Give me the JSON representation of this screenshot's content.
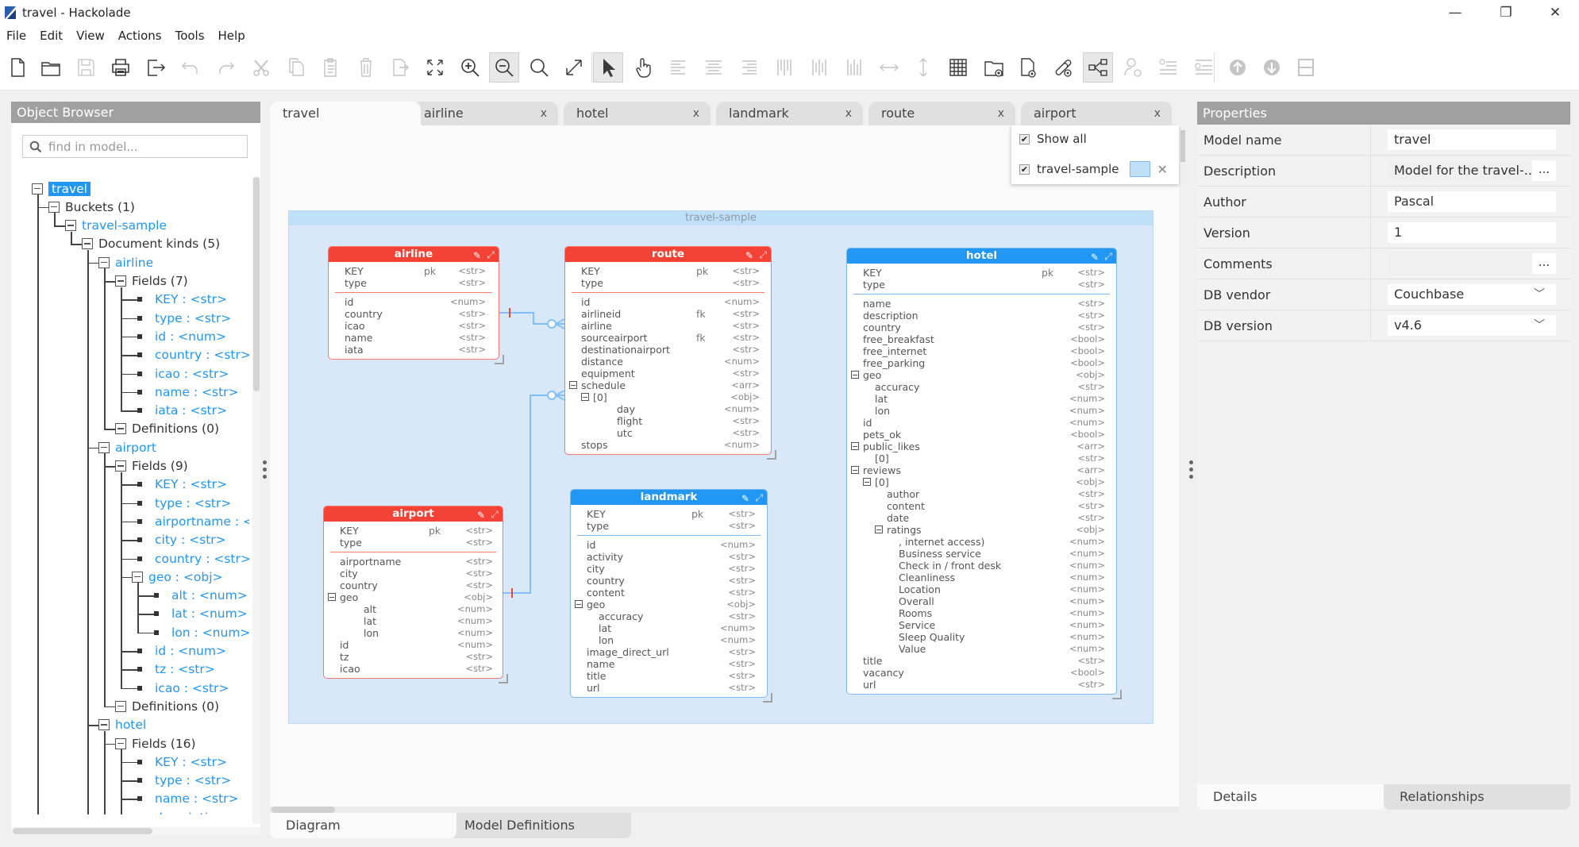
{
  "window": {
    "title": "travel - Hackolade",
    "controls": {
      "minimize": "—",
      "restore": "❐",
      "close": "✕"
    }
  },
  "menu": [
    "File",
    "Edit",
    "View",
    "Actions",
    "Tools",
    "Help"
  ],
  "toolbar": [
    {
      "name": "new-file-icon",
      "enabled": true
    },
    {
      "name": "open-folder-icon",
      "enabled": true
    },
    {
      "name": "save-icon",
      "enabled": false
    },
    {
      "name": "print-icon",
      "enabled": true
    },
    {
      "name": "export-icon",
      "enabled": true
    },
    {
      "name": "undo-icon",
      "enabled": false
    },
    {
      "name": "redo-icon",
      "enabled": false
    },
    {
      "name": "cut-icon",
      "enabled": false
    },
    {
      "name": "copy-icon",
      "enabled": false
    },
    {
      "name": "paste-icon",
      "enabled": false
    },
    {
      "name": "delete-icon",
      "enabled": false
    },
    {
      "name": "duplicate-icon",
      "enabled": false
    },
    {
      "name": "fit-to-screen-icon",
      "enabled": true
    },
    {
      "name": "zoom-in-icon",
      "enabled": true
    },
    {
      "name": "zoom-out-icon",
      "enabled": true,
      "active": true
    },
    {
      "name": "zoom-actual-icon",
      "enabled": true
    },
    {
      "name": "expand-icon",
      "enabled": true
    },
    {
      "name": "pointer-icon",
      "enabled": true,
      "active": true
    },
    {
      "name": "pan-hand-icon",
      "enabled": true
    },
    {
      "name": "align-left-icon",
      "enabled": false
    },
    {
      "name": "align-center-icon",
      "enabled": false
    },
    {
      "name": "align-right-icon",
      "enabled": false
    },
    {
      "name": "align-top-icon",
      "enabled": false
    },
    {
      "name": "align-middle-icon",
      "enabled": false
    },
    {
      "name": "align-bottom-icon",
      "enabled": false
    },
    {
      "name": "distribute-horizontal-icon",
      "enabled": false
    },
    {
      "name": "distribute-vertical-icon",
      "enabled": false
    },
    {
      "name": "grid-icon",
      "enabled": true
    },
    {
      "name": "add-container-icon",
      "enabled": true
    },
    {
      "name": "add-entity-icon",
      "enabled": true
    },
    {
      "name": "add-relationship-icon",
      "enabled": true
    },
    {
      "name": "show-relationships-icon",
      "enabled": true,
      "active": true
    },
    {
      "name": "add-attribute-icon",
      "enabled": false
    },
    {
      "name": "insert-field-icon",
      "enabled": false
    },
    {
      "name": "append-field-icon",
      "enabled": false
    },
    {
      "name": "move-up-icon",
      "enabled": false
    },
    {
      "name": "move-down-icon",
      "enabled": false
    },
    {
      "name": "split-view-icon",
      "enabled": false
    }
  ],
  "object_browser": {
    "title": "Object Browser",
    "search_placeholder": "find in model...",
    "tree": [
      {
        "label": "travel",
        "level": 0,
        "kind": "box",
        "selected": true
      },
      {
        "label": "Buckets (1)",
        "level": 1,
        "kind": "box"
      },
      {
        "label": "travel-sample",
        "level": 2,
        "kind": "box",
        "blue": true
      },
      {
        "label": "Document kinds (5)",
        "level": 3,
        "kind": "box"
      },
      {
        "label": "airline",
        "level": 4,
        "kind": "box",
        "blue": true
      },
      {
        "label": "Fields (7)",
        "level": 5,
        "kind": "box"
      },
      {
        "label": "KEY : <str>",
        "level": 6,
        "kind": "leaf",
        "blue": true
      },
      {
        "label": "type : <str>",
        "level": 6,
        "kind": "leaf",
        "blue": true
      },
      {
        "label": "id : <num>",
        "level": 6,
        "kind": "leaf",
        "blue": true
      },
      {
        "label": "country : <str>",
        "level": 6,
        "kind": "leaf",
        "blue": true
      },
      {
        "label": "icao : <str>",
        "level": 6,
        "kind": "leaf",
        "blue": true
      },
      {
        "label": "name : <str>",
        "level": 6,
        "kind": "leaf",
        "blue": true
      },
      {
        "label": "iata : <str>",
        "level": 6,
        "kind": "leaf",
        "blue": true
      },
      {
        "label": "Definitions (0)",
        "level": 5,
        "kind": "box"
      },
      {
        "label": "airport",
        "level": 4,
        "kind": "box",
        "blue": true
      },
      {
        "label": "Fields (9)",
        "level": 5,
        "kind": "box"
      },
      {
        "label": "KEY : <str>",
        "level": 6,
        "kind": "leaf",
        "blue": true
      },
      {
        "label": "type : <str>",
        "level": 6,
        "kind": "leaf",
        "blue": true
      },
      {
        "label": "airportname : <str>",
        "level": 6,
        "kind": "leaf",
        "blue": true
      },
      {
        "label": "city : <str>",
        "level": 6,
        "kind": "leaf",
        "blue": true
      },
      {
        "label": "country : <str>",
        "level": 6,
        "kind": "leaf",
        "blue": true
      },
      {
        "label": "geo : <obj>",
        "level": 6,
        "kind": "box",
        "blue": true
      },
      {
        "label": "alt : <num>",
        "level": 7,
        "kind": "leaf",
        "blue": true
      },
      {
        "label": "lat : <num>",
        "level": 7,
        "kind": "leaf",
        "blue": true
      },
      {
        "label": "lon : <num>",
        "level": 7,
        "kind": "leaf",
        "blue": true
      },
      {
        "label": "id : <num>",
        "level": 6,
        "kind": "leaf",
        "blue": true
      },
      {
        "label": "tz : <str>",
        "level": 6,
        "kind": "leaf",
        "blue": true
      },
      {
        "label": "icao : <str>",
        "level": 6,
        "kind": "leaf",
        "blue": true
      },
      {
        "label": "Definitions (0)",
        "level": 5,
        "kind": "box"
      },
      {
        "label": "hotel",
        "level": 4,
        "kind": "box",
        "blue": true
      },
      {
        "label": "Fields (16)",
        "level": 5,
        "kind": "box"
      },
      {
        "label": "KEY : <str>",
        "level": 6,
        "kind": "leaf",
        "blue": true
      },
      {
        "label": "type : <str>",
        "level": 6,
        "kind": "leaf",
        "blue": true
      },
      {
        "label": "name : <str>",
        "level": 6,
        "kind": "leaf",
        "blue": true
      },
      {
        "label": "description : <str>",
        "level": 6,
        "kind": "leaf",
        "blue": true
      }
    ]
  },
  "tabs": [
    {
      "label": "travel",
      "active": true,
      "closable": false
    },
    {
      "label": "airline",
      "closable": true
    },
    {
      "label": "hotel",
      "closable": true
    },
    {
      "label": "landmark",
      "closable": true
    },
    {
      "label": "route",
      "closable": true
    },
    {
      "label": "airport",
      "closable": true
    }
  ],
  "tab_close_glyph": "x",
  "filter_popup": {
    "show_all_label": "Show all",
    "show_all_checked": true,
    "items": [
      {
        "label": "travel-sample",
        "checked": true,
        "color": "#bfe0f8"
      }
    ]
  },
  "diagram": {
    "container_label": "travel-sample",
    "colors": {
      "red": "#f44336",
      "blue": "#2196f3",
      "container": "#d8e8f8",
      "relationship": "#7fbfff"
    },
    "entities": [
      {
        "id": "airline",
        "title": "airline",
        "color": "red",
        "keys": [
          {
            "name": "KEY",
            "key": "pk",
            "type": "<str>"
          },
          {
            "name": "type",
            "type": "<str>"
          }
        ],
        "fields": [
          {
            "name": "id",
            "type": "<num>"
          },
          {
            "name": "country",
            "type": "<str>"
          },
          {
            "name": "icao",
            "type": "<str>"
          },
          {
            "name": "name",
            "type": "<str>"
          },
          {
            "name": "iata",
            "type": "<str>"
          }
        ]
      },
      {
        "id": "route",
        "title": "route",
        "color": "red",
        "keys": [
          {
            "name": "KEY",
            "key": "pk",
            "type": "<str>"
          },
          {
            "name": "type",
            "type": "<str>"
          }
        ],
        "fields": [
          {
            "name": "id",
            "type": "<num>"
          },
          {
            "name": "airlineid",
            "key": "fk",
            "type": "<str>"
          },
          {
            "name": "airline",
            "type": "<str>"
          },
          {
            "name": "sourceairport",
            "key": "fk",
            "type": "<str>"
          },
          {
            "name": "destinationairport",
            "type": "<str>"
          },
          {
            "name": "distance",
            "type": "<num>"
          },
          {
            "name": "equipment",
            "type": "<str>"
          },
          {
            "name": "schedule",
            "type": "<arr>",
            "collapsible": true
          },
          {
            "name": "[0]",
            "type": "<obj>",
            "indent": 1,
            "collapsible": true
          },
          {
            "name": "day",
            "type": "<num>",
            "indent": 3
          },
          {
            "name": "flight",
            "type": "<str>",
            "indent": 3
          },
          {
            "name": "utc",
            "type": "<str>",
            "indent": 3
          },
          {
            "name": "stops",
            "type": "<num>"
          }
        ]
      },
      {
        "id": "hotel",
        "title": "hotel",
        "color": "blue",
        "keys": [
          {
            "name": "KEY",
            "key": "pk",
            "type": "<str>"
          },
          {
            "name": "type",
            "type": "<str>"
          }
        ],
        "fields": [
          {
            "name": "name",
            "type": "<str>"
          },
          {
            "name": "description",
            "type": "<str>"
          },
          {
            "name": "country",
            "type": "<str>"
          },
          {
            "name": "free_breakfast",
            "type": "<bool>"
          },
          {
            "name": "free_internet",
            "type": "<bool>"
          },
          {
            "name": "free_parking",
            "type": "<bool>"
          },
          {
            "name": "geo",
            "type": "<obj>",
            "collapsible": true
          },
          {
            "name": "accuracy",
            "type": "<str>",
            "indent": 1
          },
          {
            "name": "lat",
            "type": "<num>",
            "indent": 1
          },
          {
            "name": "lon",
            "type": "<num>",
            "indent": 1
          },
          {
            "name": "id",
            "type": "<num>"
          },
          {
            "name": "pets_ok",
            "type": "<bool>"
          },
          {
            "name": "public_likes",
            "type": "<arr>",
            "collapsible": true
          },
          {
            "name": "[0]",
            "type": "<str>",
            "indent": 1
          },
          {
            "name": "reviews",
            "type": "<arr>",
            "collapsible": true
          },
          {
            "name": "[0]",
            "type": "<obj>",
            "indent": 1,
            "collapsible": true
          },
          {
            "name": "author",
            "type": "<str>",
            "indent": 2
          },
          {
            "name": "content",
            "type": "<str>",
            "indent": 2
          },
          {
            "name": "date",
            "type": "<str>",
            "indent": 2
          },
          {
            "name": "ratings",
            "type": "<obj>",
            "indent": 2,
            "collapsible": true
          },
          {
            "name": ", internet access)",
            "type": "<num>",
            "indent": 3
          },
          {
            "name": "Business service",
            "type": "<num>",
            "indent": 3
          },
          {
            "name": "Check in / front desk",
            "type": "<num>",
            "indent": 3
          },
          {
            "name": "Cleanliness",
            "type": "<num>",
            "indent": 3
          },
          {
            "name": "Location",
            "type": "<num>",
            "indent": 3
          },
          {
            "name": "Overall",
            "type": "<num>",
            "indent": 3
          },
          {
            "name": "Rooms",
            "type": "<num>",
            "indent": 3
          },
          {
            "name": "Service",
            "type": "<num>",
            "indent": 3
          },
          {
            "name": "Sleep Quality",
            "type": "<num>",
            "indent": 3
          },
          {
            "name": "Value",
            "type": "<num>",
            "indent": 3
          },
          {
            "name": "title",
            "type": "<str>"
          },
          {
            "name": "vacancy",
            "type": "<bool>"
          },
          {
            "name": "url",
            "type": "<str>"
          }
        ]
      },
      {
        "id": "airport",
        "title": "airport",
        "color": "red",
        "keys": [
          {
            "name": "KEY",
            "key": "pk",
            "type": "<str>"
          },
          {
            "name": "type",
            "type": "<str>"
          }
        ],
        "fields": [
          {
            "name": "airportname",
            "type": "<str>"
          },
          {
            "name": "city",
            "type": "<str>"
          },
          {
            "name": "country",
            "type": "<str>"
          },
          {
            "name": "geo",
            "type": "<obj>",
            "collapsible": true
          },
          {
            "name": "alt",
            "type": "<num>",
            "indent": 2
          },
          {
            "name": "lat",
            "type": "<num>",
            "indent": 2
          },
          {
            "name": "lon",
            "type": "<num>",
            "indent": 2
          },
          {
            "name": "id",
            "type": "<num>"
          },
          {
            "name": "tz",
            "type": "<str>"
          },
          {
            "name": "icao",
            "type": "<str>"
          }
        ]
      },
      {
        "id": "landmark",
        "title": "landmark",
        "color": "blue",
        "keys": [
          {
            "name": "KEY",
            "key": "pk",
            "type": "<str>"
          },
          {
            "name": "type",
            "type": "<str>"
          }
        ],
        "fields": [
          {
            "name": "id",
            "type": "<num>"
          },
          {
            "name": "activity",
            "type": "<str>"
          },
          {
            "name": "city",
            "type": "<str>"
          },
          {
            "name": "country",
            "type": "<str>"
          },
          {
            "name": "content",
            "type": "<str>"
          },
          {
            "name": "geo",
            "type": "<obj>",
            "collapsible": true
          },
          {
            "name": "accuracy",
            "type": "<str>",
            "indent": 1
          },
          {
            "name": "lat",
            "type": "<num>",
            "indent": 1
          },
          {
            "name": "lon",
            "type": "<num>",
            "indent": 1
          },
          {
            "name": "image_direct_url",
            "type": "<str>"
          },
          {
            "name": "name",
            "type": "<str>"
          },
          {
            "name": "title",
            "type": "<str>"
          },
          {
            "name": "url",
            "type": "<str>"
          }
        ]
      }
    ],
    "relationships": [
      {
        "from": "airline.id",
        "to": "route.airlineid",
        "cardinality": "one-to-zero-or-many"
      },
      {
        "from": "airport",
        "to": "route.sourceairport",
        "cardinality": "one-to-zero-or-many"
      }
    ]
  },
  "bottom_tabs_center": [
    {
      "label": "Diagram",
      "active": true
    },
    {
      "label": "Model Definitions"
    }
  ],
  "properties": {
    "title": "Properties",
    "rows": [
      {
        "label": "Model name",
        "value": "travel",
        "kind": "text"
      },
      {
        "label": "Description",
        "value": "Model for the travel-...",
        "kind": "dots"
      },
      {
        "label": "Author",
        "value": "Pascal",
        "kind": "text"
      },
      {
        "label": "Version",
        "value": "1",
        "kind": "text"
      },
      {
        "label": "Comments",
        "value": "",
        "kind": "dots"
      },
      {
        "label": "DB vendor",
        "value": "Couchbase",
        "kind": "select"
      },
      {
        "label": "DB version",
        "value": "v4.6",
        "kind": "select"
      }
    ],
    "dots_label": "...",
    "bottom_tabs": [
      {
        "label": "Details",
        "active": true
      },
      {
        "label": "Relationships"
      }
    ]
  }
}
